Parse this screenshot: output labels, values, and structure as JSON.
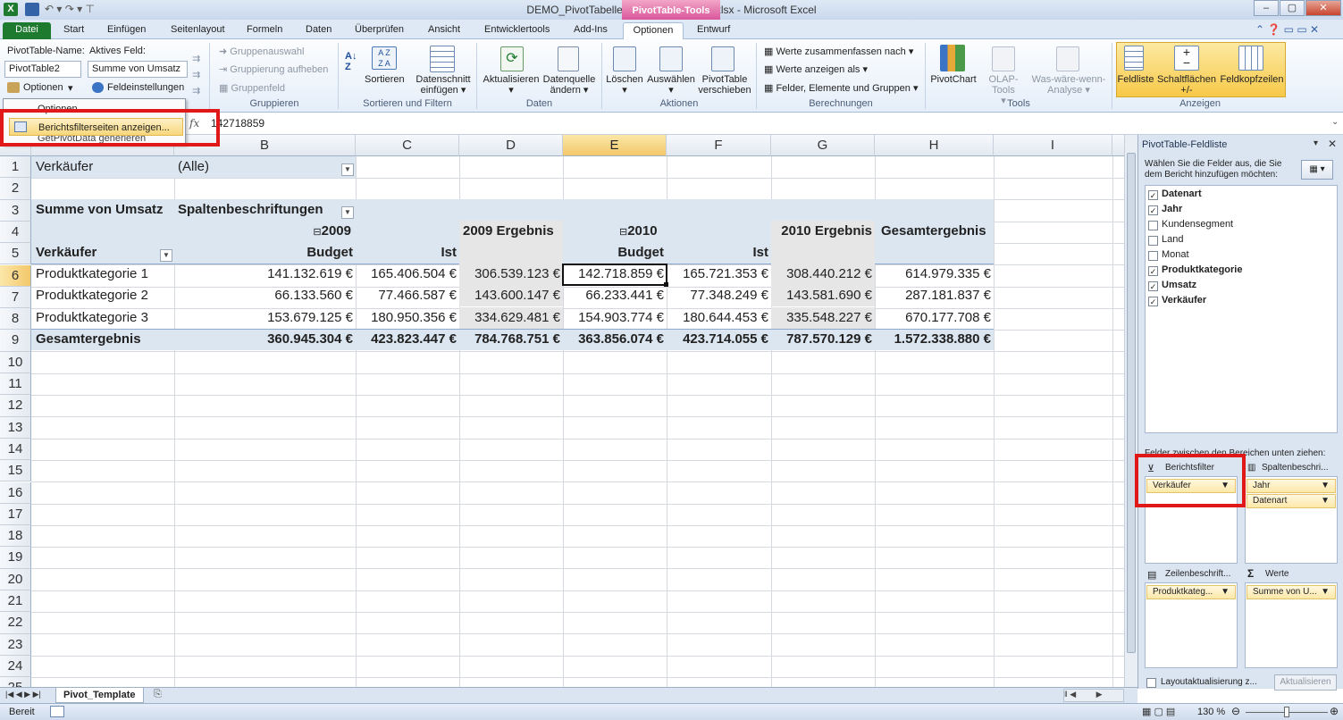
{
  "window": {
    "title": "DEMO_PivotTabelle_Berichteerzeugen.xlsx - Microsoft Excel",
    "context_tab": "PivotTable-Tools"
  },
  "tabs": [
    "Datei",
    "Start",
    "Einfügen",
    "Seitenlayout",
    "Formeln",
    "Daten",
    "Überprüfen",
    "Ansicht",
    "Entwicklertools",
    "Add-Ins",
    "Optionen",
    "Entwurf"
  ],
  "ribbon": {
    "pt_name_label": "PivotTable-Name:",
    "pt_name_value": "PivotTable2",
    "active_field_label": "Aktives Feld:",
    "active_field_value": "Summe von Umsatz",
    "optionen": "Optionen",
    "feldeinstellungen": "Feldeinstellungen",
    "gruppenauswahl": "Gruppenauswahl",
    "gruppierung_aufheben": "Gruppierung aufheben",
    "gruppenfeld": "Gruppenfeld",
    "group_gruppieren": "Gruppieren",
    "sortieren": "Sortieren",
    "datenschnitt1": "Datenschnitt",
    "datenschnitt2": "einfügen",
    "group_sort": "Sortieren und Filtern",
    "aktualisieren": "Aktualisieren",
    "datenquelle1": "Datenquelle",
    "datenquelle2": "ändern",
    "group_daten": "Daten",
    "loeschen": "Löschen",
    "auswaehlen": "Auswählen",
    "pt_verschieben1": "PivotTable",
    "pt_verschieben2": "verschieben",
    "group_aktionen": "Aktionen",
    "werte_zusammenfassen": "Werte zusammenfassen nach",
    "werte_anzeigen": "Werte anzeigen als",
    "felder_elemente": "Felder, Elemente und Gruppen",
    "group_berechnungen": "Berechnungen",
    "pivotchart": "PivotChart",
    "olap": "OLAP-Tools",
    "waswaere1": "Was-wäre-wenn-",
    "waswaere2": "Analyse",
    "group_tools": "Tools",
    "feldliste": "Feldliste",
    "schaltflaechen1": "Schaltflächen",
    "schaltflaechen2": "+/-",
    "feldkopfzeilen": "Feldkopfzeilen",
    "group_anzeigen": "Anzeigen"
  },
  "dropdown": {
    "item1": "Optionen",
    "item2": "Berichtsfilterseiten anzeigen...",
    "item3": "GetPivotData generieren"
  },
  "formula": {
    "fx": "fx",
    "value": "142718859"
  },
  "columns": [
    "B",
    "C",
    "D",
    "E",
    "F",
    "G",
    "H",
    "I"
  ],
  "rows": [
    "1",
    "2",
    "3",
    "4",
    "5",
    "6",
    "7",
    "8",
    "9",
    "10",
    "11",
    "12",
    "13",
    "14",
    "15",
    "16",
    "17",
    "18",
    "19",
    "20",
    "21",
    "22",
    "23",
    "24",
    "25"
  ],
  "pivot": {
    "filter_label": "Verkäufer",
    "filter_value": "(Alle)",
    "sum_label": "Summe von Umsatz",
    "col_labels": "Spaltenbeschriftungen",
    "y2009": "2009",
    "y2009_result": "2009 Ergebnis",
    "y2010": "2010",
    "y2010_result": "2010 Ergebnis",
    "grand": "Gesamtergebnis",
    "row_field": "Verkäufer",
    "budget": "Budget",
    "ist": "Ist",
    "data": [
      [
        "Produktkategorie 1",
        "141.132.619 €",
        "165.406.504 €",
        "306.539.123 €",
        "142.718.859 €",
        "165.721.353 €",
        "308.440.212 €",
        "614.979.335 €"
      ],
      [
        "Produktkategorie 2",
        "66.133.560 €",
        "77.466.587 €",
        "143.600.147 €",
        "66.233.441 €",
        "77.348.249 €",
        "143.581.690 €",
        "287.181.837 €"
      ],
      [
        "Produktkategorie 3",
        "153.679.125 €",
        "180.950.356 €",
        "334.629.481 €",
        "154.903.774 €",
        "180.644.453 €",
        "335.548.227 €",
        "670.177.708 €"
      ],
      [
        "Gesamtergebnis",
        "360.945.304 €",
        "423.823.447 €",
        "784.768.751 €",
        "363.856.074 €",
        "423.714.055 €",
        "787.570.129 €",
        "1.572.338.880 €"
      ]
    ]
  },
  "fieldlist": {
    "title": "PivotTable-Feldliste",
    "instruction": "Wählen Sie die Felder aus, die Sie dem Bericht hinzufügen möchten:",
    "fields": [
      {
        "name": "Datenart",
        "checked": true
      },
      {
        "name": "Jahr",
        "checked": true
      },
      {
        "name": "Kundensegment",
        "checked": false
      },
      {
        "name": "Land",
        "checked": false
      },
      {
        "name": "Monat",
        "checked": false
      },
      {
        "name": "Produktkategorie",
        "checked": true
      },
      {
        "name": "Umsatz",
        "checked": true
      },
      {
        "name": "Verkäufer",
        "checked": true
      }
    ],
    "drag_label": "Felder zwischen den Bereichen unten ziehen:",
    "area_filter": "Berichtsfilter",
    "area_columns": "Spaltenbeschri...",
    "area_rows": "Zeilenbeschrift...",
    "area_values": "Werte",
    "filter_item": "Verkäufer",
    "col_item1": "Jahr",
    "col_item2": "Datenart",
    "row_item": "Produktkateg...",
    "value_item": "Summe von U...",
    "defer": "Layoutaktualisierung z...",
    "update": "Aktualisieren"
  },
  "sheet_tab": "Pivot_Template",
  "status": {
    "ready": "Bereit",
    "zoom": "130 %"
  },
  "colors": {
    "accent_red": "#e01818",
    "excel_green": "#1d7a2e",
    "pivot_pink": "#d9569a"
  }
}
